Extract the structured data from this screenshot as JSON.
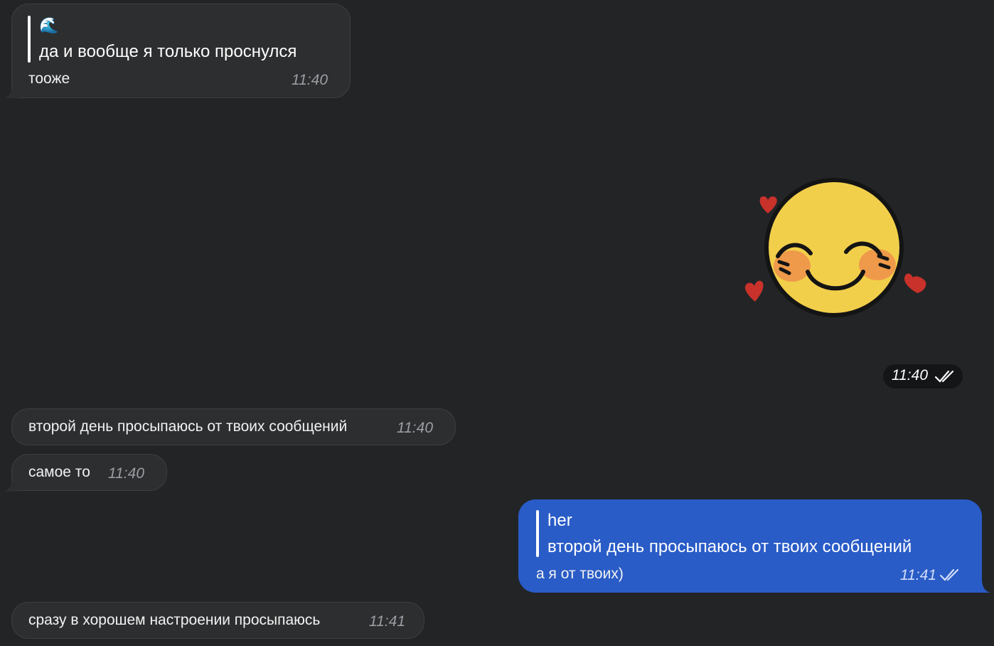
{
  "messages": [
    {
      "id": "m1",
      "direction": "incoming",
      "quote_author": "🌊",
      "quote_text": "да и вообще я только проснулся",
      "text": "тооже",
      "time": "11:40"
    },
    {
      "id": "m2",
      "direction": "outgoing",
      "type": "sticker",
      "sticker": "blushing-smiley-with-hearts",
      "time": "11:40",
      "status": "read"
    },
    {
      "id": "m3",
      "direction": "incoming",
      "text": "второй день просыпаюсь от твоих сообщений",
      "time": "11:40"
    },
    {
      "id": "m4",
      "direction": "incoming",
      "text": "самое то",
      "time": "11:40"
    },
    {
      "id": "m5",
      "direction": "outgoing",
      "quote_author": "her",
      "quote_text": "второй день просыпаюсь от твоих сообщений",
      "text": "а я от твоих)",
      "time": "11:41",
      "status": "read"
    },
    {
      "id": "m6",
      "direction": "incoming",
      "text": "сразу в хорошем настроении просыпаюсь",
      "time": "11:41"
    }
  ],
  "colors": {
    "background": "#222426",
    "incoming_bubble": "#2d2e30",
    "outgoing_bubble": "#2a5cc7",
    "sticker_face": "#f2cf4a",
    "sticker_hearts": "#c8322a"
  }
}
